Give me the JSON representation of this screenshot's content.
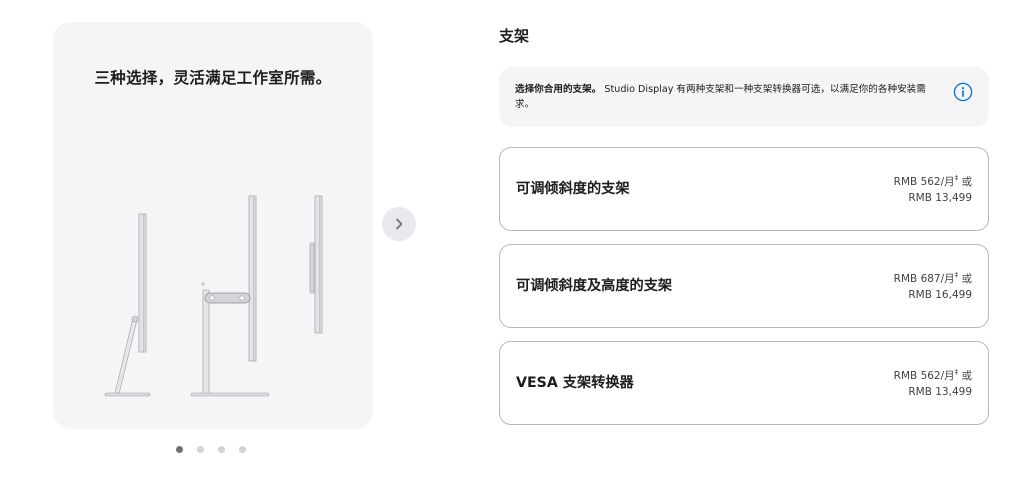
{
  "gallery": {
    "title": "三种选择，灵活满足工作室所需。",
    "next_icon": "chevron-right-icon",
    "dots": [
      {
        "active": true
      },
      {
        "active": false
      },
      {
        "active": false
      },
      {
        "active": false
      }
    ]
  },
  "section": {
    "title": "支架"
  },
  "info": {
    "bold": "选择你合用的支架。",
    "text": "Studio Display 有两种支架和一种支架转换器可选，以满足你的各种安装需求。",
    "icon": "info-circle-icon",
    "accent": "#0071e3"
  },
  "options": [
    {
      "name": "可调倾斜度的支架",
      "price_monthly": "RMB 562/月",
      "footnote": "‡",
      "or": "或",
      "price_full": "RMB 13,499"
    },
    {
      "name": "可调倾斜度及高度的支架",
      "price_monthly": "RMB 687/月",
      "footnote": "‡",
      "or": "或",
      "price_full": "RMB 16,499"
    },
    {
      "name": "VESA 支架转换器",
      "price_monthly": "RMB 562/月",
      "footnote": "‡",
      "or": "或",
      "price_full": "RMB 13,499"
    }
  ]
}
